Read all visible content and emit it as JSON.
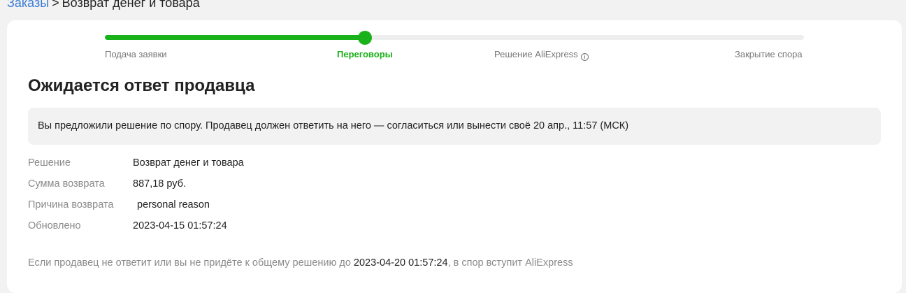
{
  "breadcrumb": {
    "link": "Заказы",
    "separator": ">",
    "current": "Возврат денег и товара"
  },
  "progress": {
    "steps": [
      {
        "label": "Подача заявки"
      },
      {
        "label": "Переговоры"
      },
      {
        "label": "Решение AliExpress"
      },
      {
        "label": "Закрытие спора"
      }
    ],
    "current_step_index": 1,
    "fill_fraction": 0.372,
    "accent_color": "#1ab21a"
  },
  "title": "Ожидается ответ продавца",
  "notice": "Вы предложили решение по спору. Продавец должен ответить на него — согласиться или вынести своё 20 апр., 11:57 (МСК)",
  "details": [
    {
      "label": "Решение",
      "value": "Возврат денег и товара"
    },
    {
      "label": "Сумма возврата",
      "value": "887,18 руб."
    },
    {
      "label": "Причина возврата",
      "value": "personal reason"
    },
    {
      "label": "Обновлено",
      "value": "2023-04-15 01:57:24"
    }
  ],
  "footer": {
    "before": "Если продавец не ответит или вы не придёте к общему решению до ",
    "date": "2023-04-20 01:57:24",
    "after": ", в спор вступит AliExpress"
  },
  "icons": {
    "info": "info-icon"
  }
}
